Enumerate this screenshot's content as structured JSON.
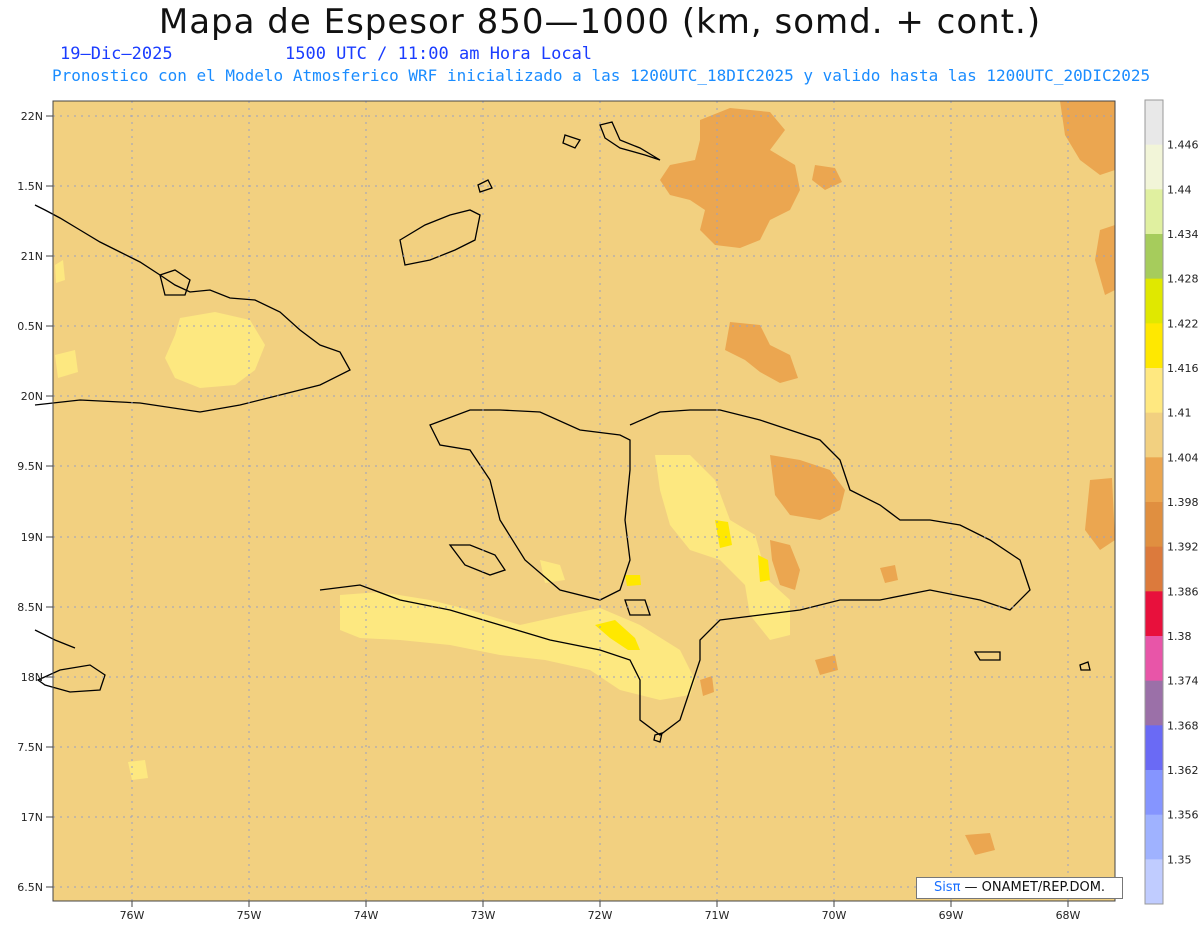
{
  "title": "Mapa de Espesor 850—1000 (km, somd. + cont.)",
  "date": "19—Dic—2025",
  "time": "1500 UTC / 11:00 am Hora Local",
  "forecast_line": "Pronostico con el Modelo Atmosferico WRF inicializado a las 1200UTC_18DIC2025 y valido hasta las  1200UTC_20DIC2025",
  "credit": {
    "brand": "Sisπ",
    "text": " — ONAMET/REP.DOM."
  },
  "lat_labels": [
    "22N",
    "1.5N",
    "21N",
    "0.5N",
    "20N",
    "9.5N",
    "19N",
    "8.5N",
    "18N",
    "7.5N",
    "17N",
    "6.5N"
  ],
  "lon_labels": [
    "76W",
    "75W",
    "74W",
    "73W",
    "72W",
    "71W",
    "70W",
    "69W",
    "68W"
  ],
  "colorbar": {
    "labels": [
      "1.446",
      "1.44",
      "1.434",
      "1.428",
      "1.422",
      "1.416",
      "1.41",
      "1.404",
      "1.398",
      "1.392",
      "1.386",
      "1.38",
      "1.374",
      "1.368",
      "1.362",
      "1.356",
      "1.35"
    ],
    "colors": [
      "#e8e8e8",
      "#f2f5d8",
      "#e0f0a0",
      "#a6cc5c",
      "#e0e800",
      "#ffe800",
      "#ffe880",
      "#f2d080",
      "#eba650",
      "#e08f40",
      "#dc7a3c",
      "#e8103c",
      "#e855a8",
      "#9b70a8",
      "#6a6af5",
      "#8595ff",
      "#9fb2ff",
      "#c0ccff"
    ]
  },
  "colors": {
    "background": "#f2d080",
    "warm": "#eba650",
    "light": "#fde880",
    "yellow": "#ffe800"
  }
}
